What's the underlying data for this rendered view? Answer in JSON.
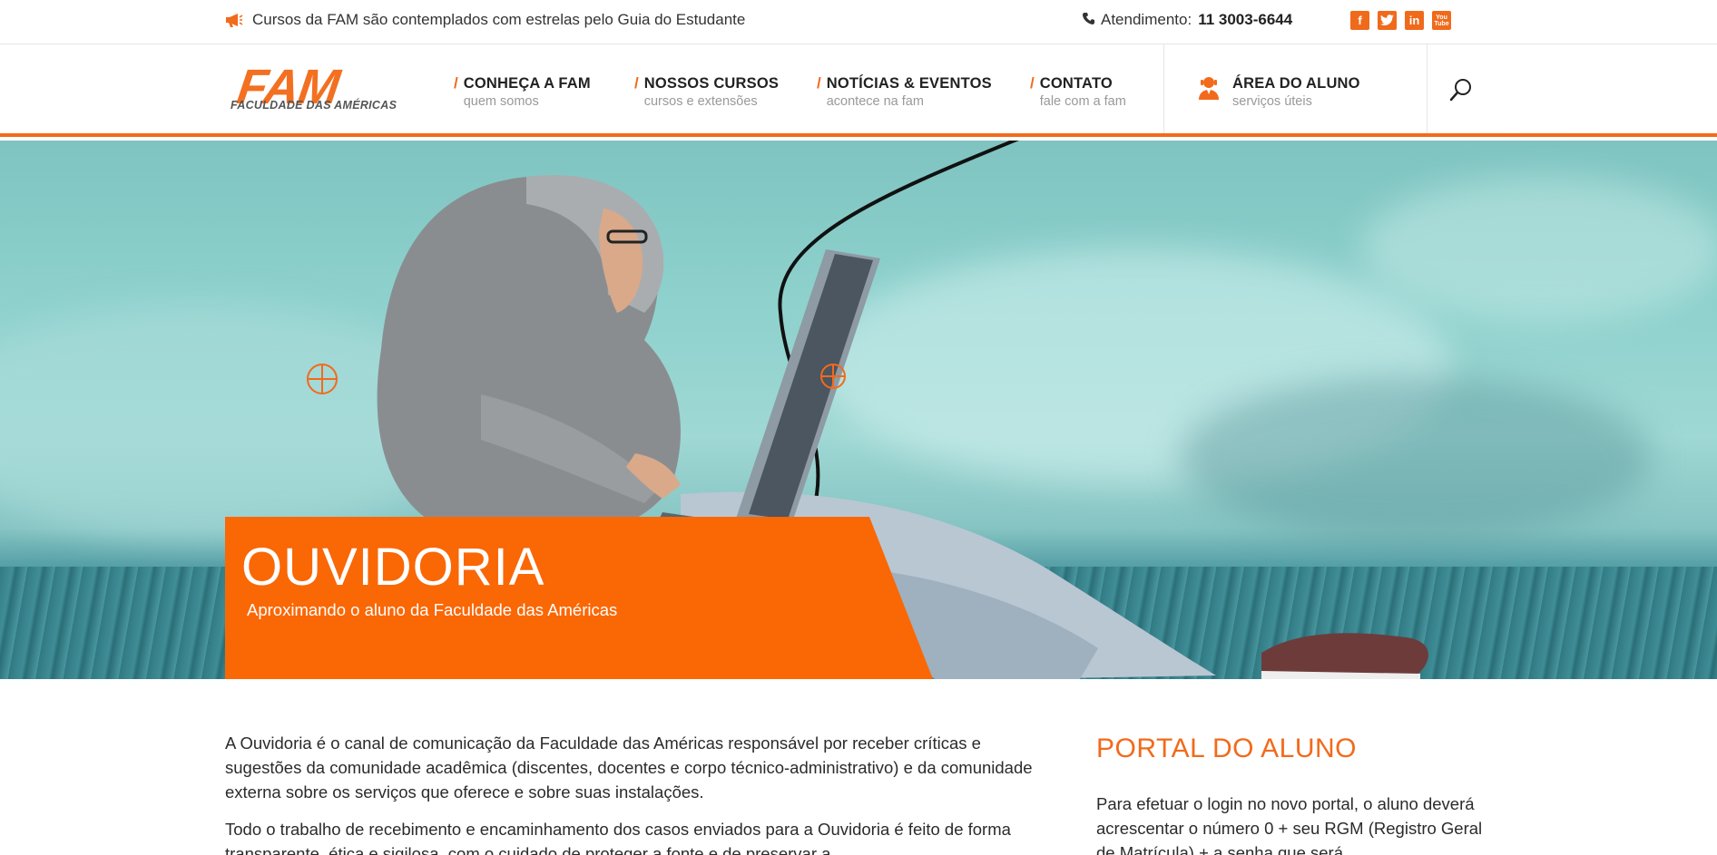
{
  "topbar": {
    "announcement": "Cursos da FAM são contemplados com estrelas pelo Guia do Estudante",
    "phone_label": "Atendimento:",
    "phone_number": "11 3003-6644",
    "social": [
      {
        "icon": "facebook-icon",
        "glyph": "f"
      },
      {
        "icon": "twitter-icon",
        "glyph": "t"
      },
      {
        "icon": "linkedin-icon",
        "glyph": "in"
      },
      {
        "icon": "youtube-icon",
        "glyph": "You Tube"
      }
    ]
  },
  "header": {
    "logo_text": "FAM",
    "logo_subtitle": "FACULDADE DAS AMÉRICAS",
    "nav": [
      {
        "title": "CONHEÇA A FAM",
        "subtitle": "quem somos"
      },
      {
        "title": "NOSSOS CURSOS",
        "subtitle": "cursos e extensões"
      },
      {
        "title": "NOTÍCIAS & EVENTOS",
        "subtitle": "acontece na fam"
      },
      {
        "title": "CONTATO",
        "subtitle": "fale com a fam"
      }
    ],
    "student_area": {
      "title": "ÁREA DO ALUNO",
      "subtitle": "serviços úteis"
    }
  },
  "hero": {
    "title": "OUVIDORIA",
    "subtitle": "Aproximando o aluno da Faculdade das Américas"
  },
  "main": {
    "paragraphs": [
      "A Ouvidoria é o canal de comunicação da Faculdade das Américas responsável por receber críticas e sugestões da comunidade acadêmica (discentes, docentes e corpo técnico-administrativo) e da comunidade externa sobre os serviços que oferece e sobre suas instalações.",
      "Todo o trabalho de recebimento e encaminhamento dos casos enviados para a Ouvidoria é feito de forma transparente, ética e sigilosa, com o cuidado de proteger a fonte e de preservar a"
    ]
  },
  "sidebar": {
    "title": "PORTAL DO ALUNO",
    "text": "Para efetuar o login no novo portal, o aluno deverá acrescentar o número 0 + seu RGM (Registro Geral de Matrícula) + a senha que será"
  },
  "colors": {
    "accent": "#f26a1b",
    "hero_box": "#fa6705"
  }
}
